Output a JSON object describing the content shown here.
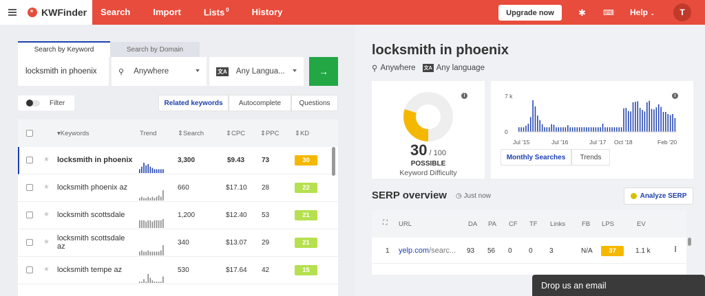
{
  "nav": {
    "logo": "KWFinder",
    "items": [
      {
        "label": "Search"
      },
      {
        "label": "Import"
      },
      {
        "label": "Lists",
        "badge": "0"
      },
      {
        "label": "History"
      }
    ],
    "upgrade_label": "Upgrade now",
    "help_label": "Help",
    "avatar_initial": "T"
  },
  "search": {
    "tabs": [
      "Search by Keyword",
      "Search by Domain"
    ],
    "keyword_value": "locksmith in phoenix",
    "location": "Anywhere",
    "language": "Any Langua..."
  },
  "filters": {
    "filter_label": "Filter",
    "tabs": [
      "Related keywords",
      "Autocomplete",
      "Questions"
    ]
  },
  "table": {
    "headers": {
      "keywords": "Keywords",
      "trend": "Trend",
      "search": "Search",
      "cpc": "CPC",
      "ppc": "PPC",
      "kd": "KD"
    },
    "rows": [
      {
        "keyword": "locksmith in phoenix",
        "search": "3,300",
        "cpc": "$9.43",
        "ppc": "73",
        "kd": "30",
        "trend": [
          3,
          5,
          8,
          6,
          7,
          5,
          4,
          3,
          3,
          3,
          3,
          3
        ]
      },
      {
        "keyword": "locksmith phoenix az",
        "search": "660",
        "cpc": "$17.10",
        "ppc": "28",
        "kd": "22",
        "trend": [
          2,
          3,
          2,
          2,
          3,
          2,
          3,
          2,
          3,
          4,
          3,
          8
        ]
      },
      {
        "keyword": "locksmith scottsdale",
        "search": "1,200",
        "cpc": "$12.40",
        "ppc": "53",
        "kd": "21",
        "trend": [
          6,
          6,
          6,
          5,
          6,
          6,
          5,
          6,
          6,
          6,
          6,
          7
        ]
      },
      {
        "keyword": "locksmith scottsdale az",
        "search": "340",
        "cpc": "$13.07",
        "ppc": "29",
        "kd": "21",
        "trend": [
          3,
          4,
          3,
          3,
          4,
          3,
          3,
          3,
          3,
          3,
          4,
          8
        ]
      },
      {
        "keyword": "locksmith tempe az",
        "search": "530",
        "cpc": "$17.64",
        "ppc": "42",
        "kd": "15",
        "trend": [
          1,
          1,
          3,
          1,
          7,
          4,
          2,
          1,
          1,
          1,
          1,
          5
        ]
      }
    ]
  },
  "detail": {
    "title": "locksmith in phoenix",
    "location": "Anywhere",
    "language": "Any language",
    "kd_value": "30",
    "kd_max": "/ 100",
    "kd_fraction": 0.3,
    "kd_label": "POSSIBLE",
    "kd_caption": "Keyword Difficulty",
    "chart_tabs": [
      "Monthly Searches",
      "Trends"
    ]
  },
  "chart_data": {
    "type": "bar",
    "ylabel": "",
    "y_ticks": [
      "7 k",
      "0"
    ],
    "ylim": [
      0,
      7000
    ],
    "x_ticks": [
      "Jul '15",
      "Jul '16",
      "Jul '17",
      "Oct '18",
      "Feb '20"
    ],
    "values": [
      900,
      900,
      900,
      1200,
      1600,
      2900,
      6200,
      5000,
      3200,
      2300,
      1500,
      900,
      900,
      900,
      1500,
      1400,
      900,
      900,
      900,
      900,
      900,
      1300,
      900,
      900,
      900,
      900,
      900,
      900,
      900,
      900,
      900,
      900,
      900,
      900,
      900,
      900,
      1600,
      900,
      900,
      900,
      900,
      900,
      900,
      900,
      900,
      4600,
      4700,
      4100,
      4000,
      5800,
      5900,
      6000,
      4700,
      4300,
      4000,
      5800,
      6100,
      4500,
      4400,
      4800,
      5400,
      4900,
      3900,
      3900,
      3500,
      3300,
      3500,
      2700
    ]
  },
  "serp": {
    "title": "SERP overview",
    "time": "Just now",
    "analyze_label": "Analyze SERP",
    "headers": {
      "url": "URL",
      "da": "DA",
      "pa": "PA",
      "cf": "CF",
      "tf": "TF",
      "links": "Links",
      "fb": "FB",
      "lps": "LPS",
      "ev": "EV"
    },
    "rows": [
      {
        "num": "1",
        "url": "yelp.com",
        "url_path": "/searc...",
        "da": "93",
        "pa": "56",
        "cf": "0",
        "tf": "0",
        "links": "3",
        "fb": "N/A",
        "lps": "37",
        "ev": "1.1 k"
      }
    ]
  },
  "chat": {
    "label": "Drop us an email"
  },
  "colors": {
    "accent": "#e74c3c",
    "blue": "#1e40af",
    "kd_orange": "#f5b800",
    "kd_green": "#b6e04f",
    "go": "#22a744"
  }
}
